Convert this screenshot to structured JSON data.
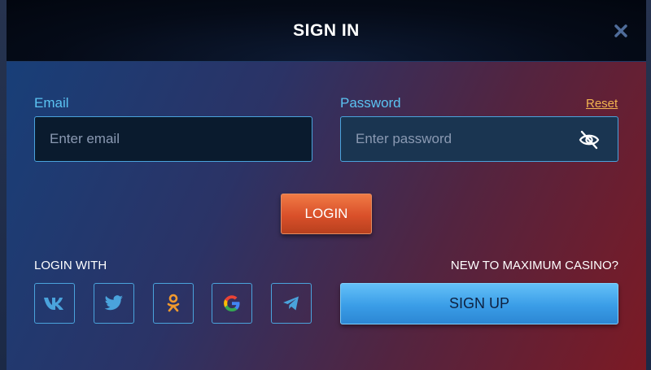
{
  "modal": {
    "title": "SIGN IN"
  },
  "email": {
    "label": "Email",
    "placeholder": "Enter email",
    "value": ""
  },
  "password": {
    "label": "Password",
    "placeholder": "Enter password",
    "value": "",
    "reset_label": "Reset"
  },
  "login_button": "LOGIN",
  "social": {
    "label": "LOGIN WITH",
    "providers": [
      "vk-icon",
      "twitter-icon",
      "odnoklassniki-icon",
      "google-icon",
      "telegram-icon"
    ]
  },
  "signup": {
    "prompt": "NEW TO MAXIMUM CASINO?",
    "button_label": "SIGN UP"
  },
  "colors": {
    "accent_blue": "#5bc3f2",
    "login_orange": "#d9502a",
    "reset_link": "#f2b450",
    "signup_blue": "#3a9de7"
  }
}
